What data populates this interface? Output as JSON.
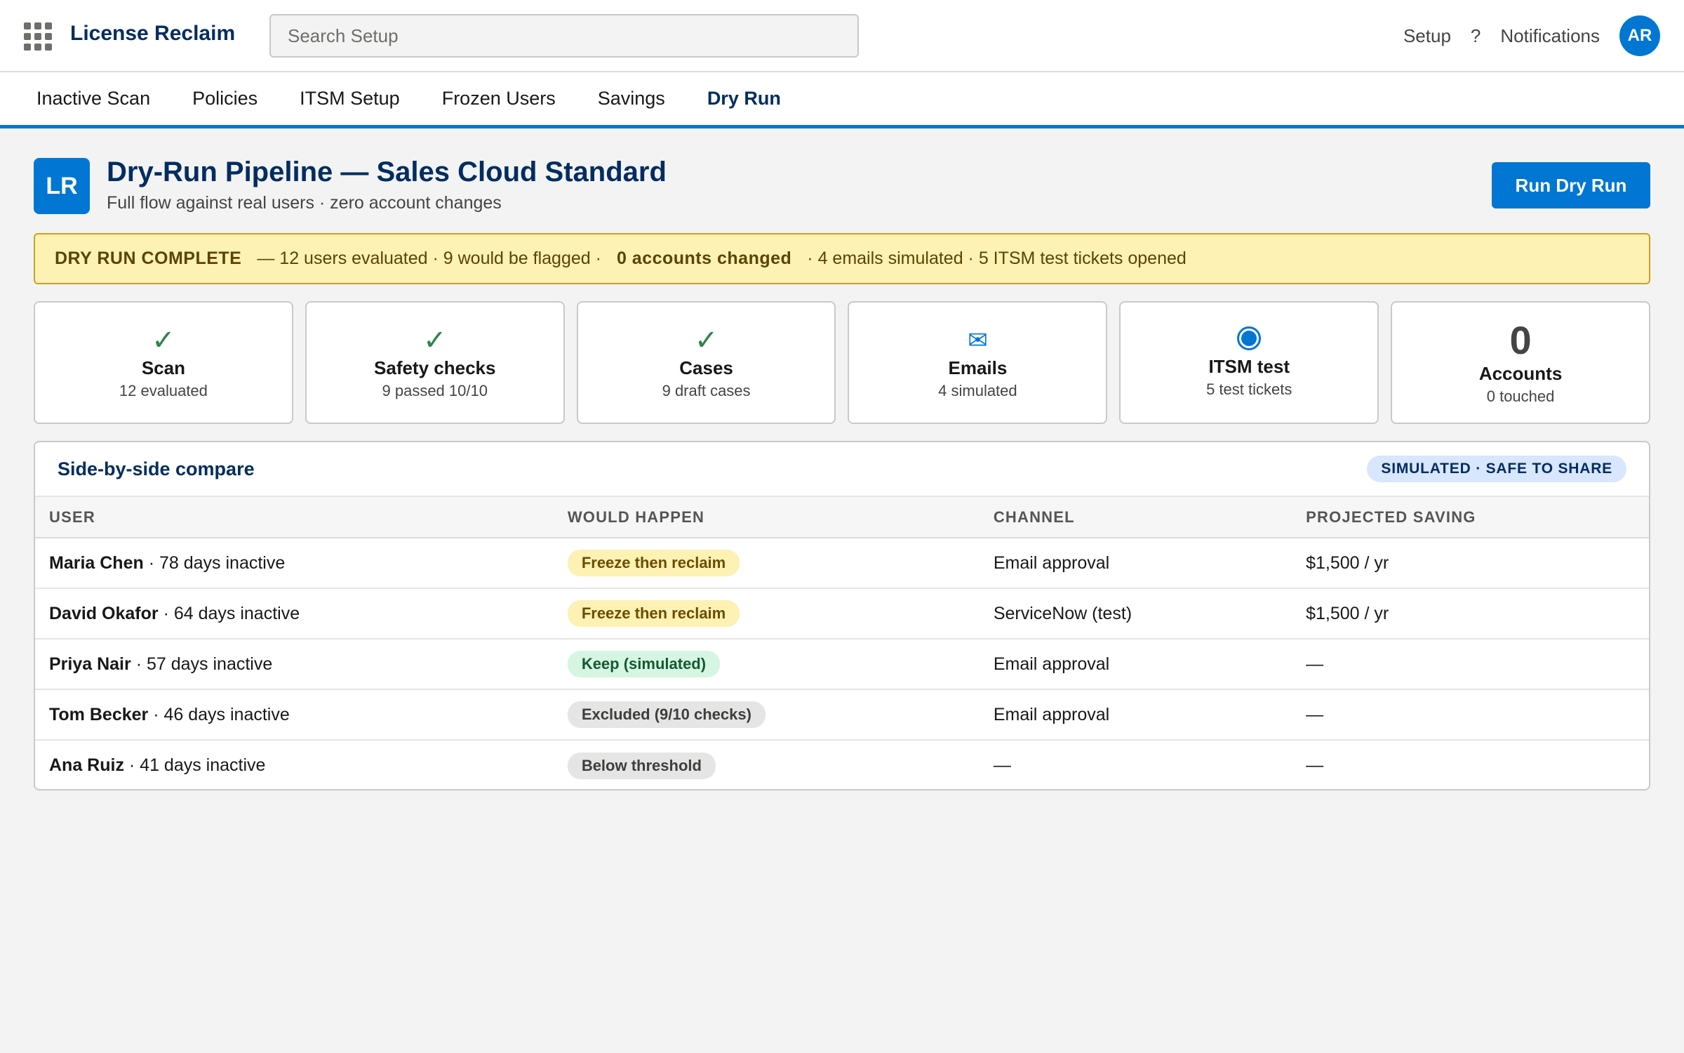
{
  "header": {
    "app_name": "License Reclaim",
    "search_placeholder": "Search Setup",
    "setup_label": "Setup",
    "help_label": "?",
    "notifications_label": "Notifications",
    "avatar_initials": "AR"
  },
  "tabs": [
    {
      "label": "Inactive Scan"
    },
    {
      "label": "Policies"
    },
    {
      "label": "ITSM Setup"
    },
    {
      "label": "Frozen Users"
    },
    {
      "label": "Savings"
    },
    {
      "label": "Dry Run"
    }
  ],
  "active_tab": "Dry Run",
  "page": {
    "icon_text": "LR",
    "title": "Dry-Run Pipeline — Sales Cloud Standard",
    "subtitle": "Full flow against real users · zero account changes",
    "run_button": "Run Dry Run"
  },
  "banner": {
    "status": "DRY RUN COMPLETE",
    "part1": "— 12 users evaluated · 9 would be flagged ·",
    "highlight": "0 accounts changed",
    "part2": "· 4 emails simulated · 5 ITSM test tickets opened"
  },
  "steps": [
    {
      "icon": "check-icon",
      "title": "Scan",
      "detail": "12 evaluated"
    },
    {
      "icon": "check-icon",
      "title": "Safety checks",
      "detail": "9 passed 10/10"
    },
    {
      "icon": "check-icon",
      "title": "Cases",
      "detail": "9 draft cases"
    },
    {
      "icon": "envelope-icon",
      "title": "Emails",
      "detail": "4 simulated"
    },
    {
      "icon": "radio-icon",
      "title": "ITSM test",
      "detail": "5 test tickets"
    },
    {
      "icon": "none",
      "value": "0",
      "title": "Accounts",
      "detail": "0 touched"
    }
  ],
  "compare": {
    "title": "Side-by-side compare",
    "badge": "SIMULATED · SAFE TO SHARE",
    "columns": [
      "USER",
      "WOULD HAPPEN",
      "CHANNEL",
      "PROJECTED SAVING"
    ],
    "rows": [
      {
        "name": "Maria Chen",
        "inactive": "· 78 days inactive",
        "action": "Freeze then reclaim",
        "action_style": "warn",
        "channel": "Email approval",
        "saving": "$1,500 / yr"
      },
      {
        "name": "David Okafor",
        "inactive": "· 64 days inactive",
        "action": "Freeze then reclaim",
        "action_style": "warn",
        "channel": "ServiceNow (test)",
        "saving": "$1,500 / yr"
      },
      {
        "name": "Priya Nair",
        "inactive": "· 57 days inactive",
        "action": "Keep (simulated)",
        "action_style": "ok",
        "channel": "Email approval",
        "saving": "—"
      },
      {
        "name": "Tom Becker",
        "inactive": "· 46 days inactive",
        "action": "Excluded (9/10 checks)",
        "action_style": "grey",
        "channel": "Email approval",
        "saving": "—"
      },
      {
        "name": "Ana Ruiz",
        "inactive": "· 41 days inactive",
        "action": "Below threshold",
        "action_style": "grey",
        "channel": "—",
        "saving": "—"
      }
    ]
  },
  "colors": {
    "brand": "#0176d3",
    "navy": "#032d60",
    "success": "#2e844a",
    "banner_bg": "#fdf1b3"
  }
}
